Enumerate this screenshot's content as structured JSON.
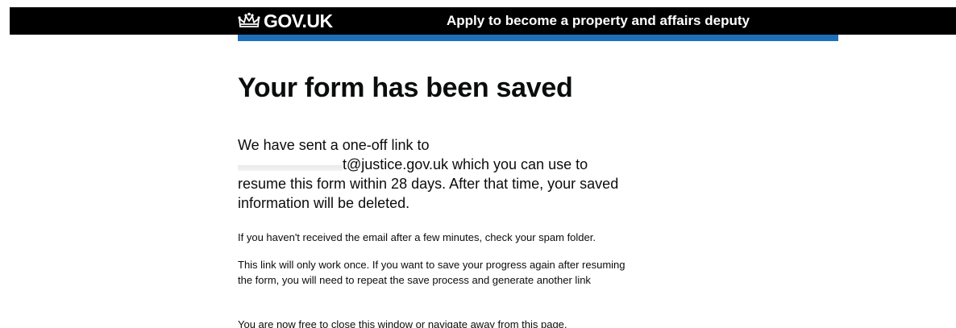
{
  "header": {
    "logo_text": "GOV.UK",
    "logo_icon": "crown-icon",
    "service_name": "Apply to become a property and affairs deputy"
  },
  "main": {
    "title": "Your form has been saved",
    "lead_before": "We have sent a one-off link to",
    "email_domain": "t@justice.gov.uk",
    "lead_after": " which you can use to resume this form within 28 days. After that time, your saved information will be deleted.",
    "paragraph_spam": "If you haven't received the email after a few minutes, check your spam folder.",
    "paragraph_once": "This link will only work once. If you want to save your progress again after resuming the form, you will need to repeat the save process and generate another link",
    "paragraph_close": "You are now free to close this window or navigate away from this page."
  },
  "colors": {
    "header_bg": "#000000",
    "accent_bar": "#1d70b8",
    "text": "#0b0c0c"
  }
}
